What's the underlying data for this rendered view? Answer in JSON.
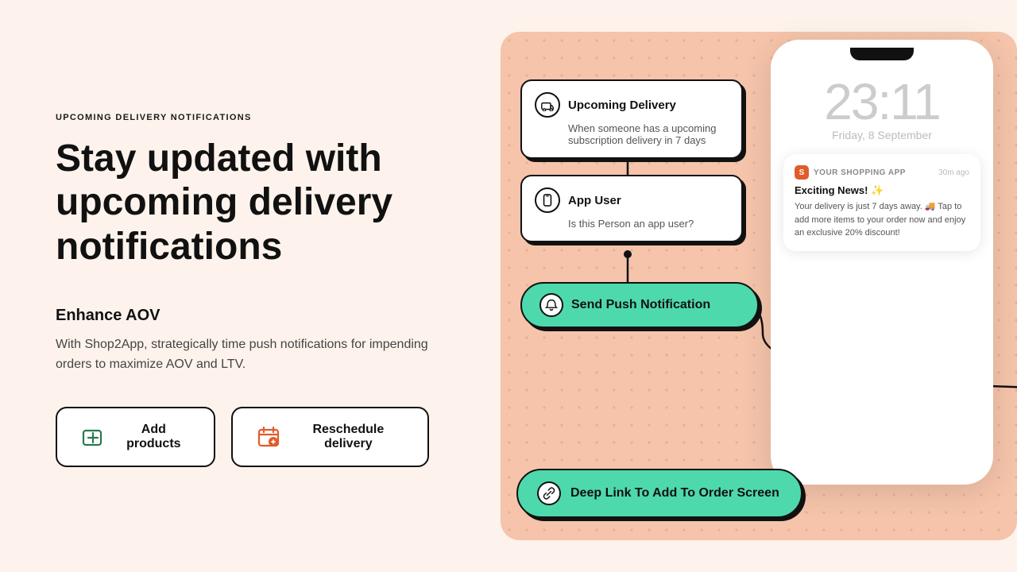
{
  "left": {
    "section_label": "UPCOMING DELIVERY NOTIFICATIONS",
    "main_heading": "Stay updated with upcoming delivery notifications",
    "enhance_title": "Enhance AOV",
    "enhance_text": "With Shop2App, strategically time push notifications for impending orders to maximize AOV and LTV.",
    "btn_add_label": "Add products",
    "btn_reschedule_label": "Reschedule delivery"
  },
  "right": {
    "flow_card_1": {
      "title": "Upcoming Delivery",
      "subtitle": "When someone has a upcoming subscription delivery in 7 days"
    },
    "flow_card_2": {
      "title": "App User",
      "subtitle": "Is this Person an app user?"
    },
    "send_push_label": "Send Push Notification",
    "deep_link_label": "Deep Link To Add To Order Screen",
    "phone": {
      "clock": "23:11",
      "date": "Friday, 8 September",
      "notification": {
        "app_name": "YOUR SHOPPING APP",
        "time_ago": "30m ago",
        "title": "Exciting News! ✨",
        "body": "Your delivery is just 7 days away. 🚚 Tap to add more items to your order now and enjoy an exclusive 20% discount!"
      }
    }
  }
}
